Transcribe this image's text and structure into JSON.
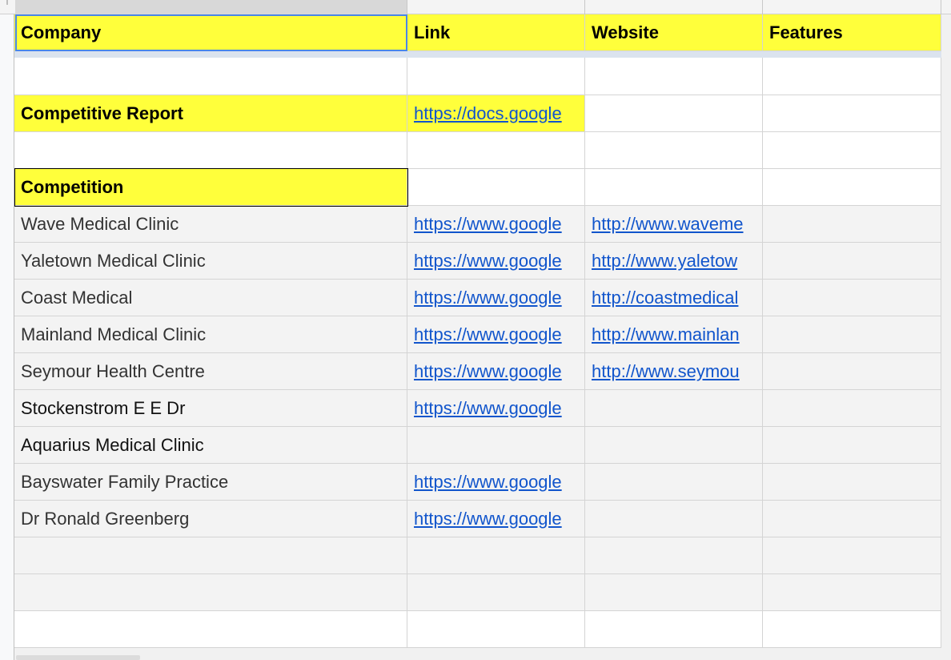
{
  "columns": [
    "Company",
    "Link",
    "Website",
    "Features"
  ],
  "competitive_report": {
    "label": "Competitive Report",
    "link": "https://docs.google"
  },
  "competition": {
    "label": "Competition",
    "rows": [
      {
        "company": "Wave Medical Clinic",
        "link": "https://www.google",
        "website": "http://www.waveme"
      },
      {
        "company": "Yaletown Medical Clinic",
        "link": "https://www.google",
        "website": "http://www.yaletow"
      },
      {
        "company": "Coast Medical",
        "link": "https://www.google",
        "website": "http://coastmedical"
      },
      {
        "company": "Mainland Medical Clinic",
        "link": "https://www.google",
        "website": "http://www.mainlan"
      },
      {
        "company": "Seymour Health Centre",
        "link": "https://www.google",
        "website": "http://www.seymou"
      },
      {
        "company": "Stockenstrom E E Dr",
        "link": "https://www.google",
        "website": ""
      },
      {
        "company": "Aquarius Medical Clinic",
        "link": "",
        "website": ""
      },
      {
        "company": "Bayswater Family Practice",
        "link": "https://www.google",
        "website": ""
      },
      {
        "company": "Dr Ronald Greenberg",
        "link": "https://www.google",
        "website": ""
      }
    ]
  },
  "colors": {
    "highlight": "#ffff3b",
    "link": "#1155cc",
    "selection": "#4a86e8"
  }
}
